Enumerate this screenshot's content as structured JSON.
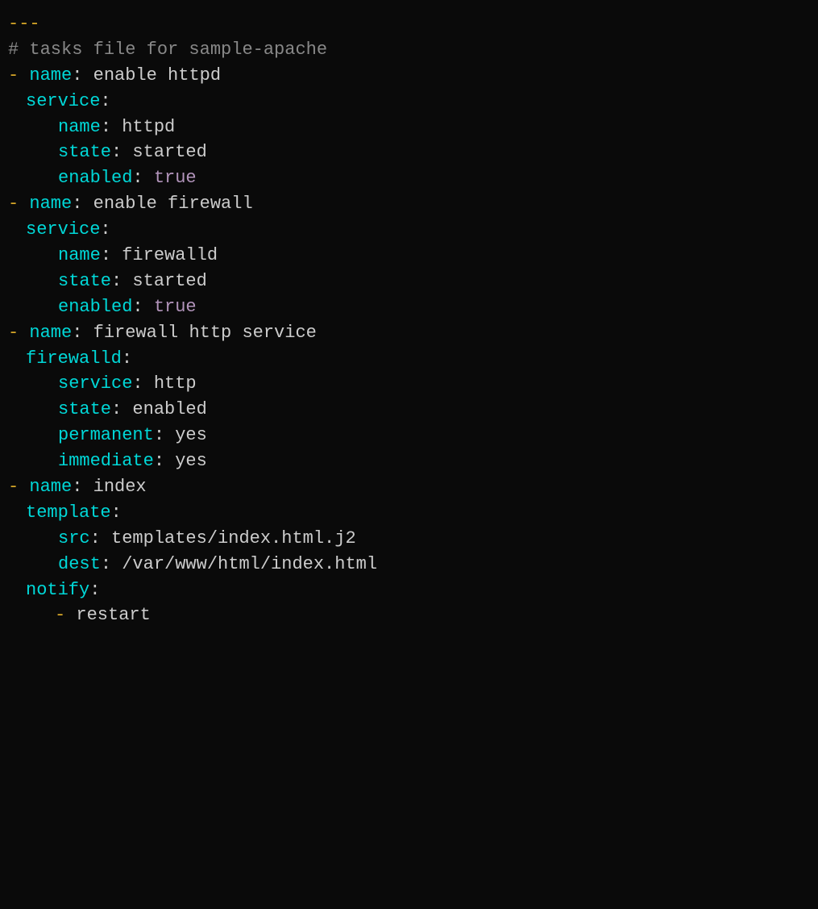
{
  "code": {
    "separator": "---",
    "comment": "# tasks file for sample-apache",
    "blocks": [
      {
        "dash": "- ",
        "name_key": "name",
        "name_colon": ":",
        "name_value": " enable httpd",
        "module": "service",
        "module_colon": ":",
        "fields": [
          {
            "key": "name",
            "colon": ":",
            "value": " httpd"
          },
          {
            "key": "state",
            "colon": ":",
            "value": " started"
          },
          {
            "key": "enabled",
            "colon": ":",
            "value": " true",
            "value_color": "purple"
          }
        ]
      },
      {
        "dash": "- ",
        "name_key": "name",
        "name_colon": ":",
        "name_value": " enable firewall",
        "module": "service",
        "module_colon": ":",
        "fields": [
          {
            "key": "name",
            "colon": ":",
            "value": " firewalld"
          },
          {
            "key": "state",
            "colon": ":",
            "value": " started"
          },
          {
            "key": "enabled",
            "colon": ":",
            "value": " true",
            "value_color": "purple"
          }
        ]
      },
      {
        "dash": "- ",
        "name_key": "name",
        "name_colon": ":",
        "name_value": " firewall http service",
        "module": "firewalld",
        "module_colon": ":",
        "fields": [
          {
            "key": "service",
            "colon": ":",
            "value": " http"
          },
          {
            "key": "state",
            "colon": ":",
            "value": " enabled"
          },
          {
            "key": "permanent",
            "colon": ":",
            "value": " yes"
          },
          {
            "key": "immediate",
            "colon": ":",
            "value": " yes"
          }
        ]
      },
      {
        "dash": "- ",
        "name_key": "name",
        "name_colon": ":",
        "name_value": " index",
        "module": "template",
        "module_colon": ":",
        "fields": [
          {
            "key": "src",
            "colon": ":",
            "value": " templates/index.html.j2"
          },
          {
            "key": "dest",
            "colon": ":",
            "value": " /var/www/html/index.html"
          }
        ],
        "notify": {
          "key": "notify",
          "colon": ":",
          "items": [
            "restart"
          ]
        }
      }
    ]
  }
}
